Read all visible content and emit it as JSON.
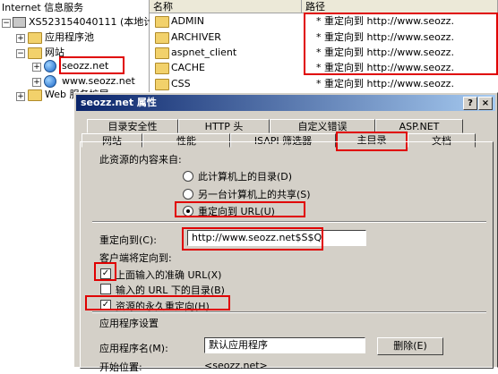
{
  "tree": {
    "root_label": "Internet 信息服务",
    "server_label": "XS523154040111 (本地计",
    "app_pools_label": "应用程序池",
    "websites_label": "网站",
    "site1_label": "seozz.net",
    "site2_label": "www.seozz.net",
    "web_ext_label": "Web 服务扩展"
  },
  "list": {
    "col_name": "名称",
    "col_path": "路径",
    "rows": [
      {
        "name": "ADMIN",
        "path": "* 重定向到 http://www.seozz."
      },
      {
        "name": "ARCHIVER",
        "path": "* 重定向到 http://www.seozz."
      },
      {
        "name": "aspnet_client",
        "path": "* 重定向到 http://www.seozz."
      },
      {
        "name": "CACHE",
        "path": "* 重定向到 http://www.seozz."
      },
      {
        "name": "CSS",
        "path": "* 重定向到 http://www.seozz."
      }
    ]
  },
  "dialog": {
    "title": "seozz.net 属性",
    "help_glyph": "?",
    "close_glyph": "×",
    "tabs_back": [
      "目录安全性",
      "HTTP 头",
      "自定义错误",
      "ASP.NET"
    ],
    "tabs_front": [
      "网站",
      "性能",
      "ISAPI 筛选器",
      "主目录",
      "文档"
    ],
    "content_source_label": "此资源的内容来自:",
    "radio_local": "此计算机上的目录(D)",
    "radio_share": "另一台计算机上的共享(S)",
    "radio_redirect": "重定向到 URL(U)",
    "redirect_label": "重定向到(C):",
    "redirect_value": "http://www.seozz.net$S$Q",
    "client_redirect_label": "客户端将定向到:",
    "chk_exact": "上面输入的准确 URL(X)",
    "chk_below": "输入的 URL 下的目录(B)",
    "chk_permanent": "资源的永久重定向(H)",
    "app_settings_label": "应用程序设置",
    "app_name_label": "应用程序名(M):",
    "app_name_value": "默认应用程序",
    "delete_button": "删除(E)",
    "start_point_label": "开始位置:",
    "start_point_value": "<seozz.net>"
  },
  "colors": {
    "highlight": "#e00000",
    "titlebar": "#0a246a",
    "face": "#d4d0c8"
  }
}
